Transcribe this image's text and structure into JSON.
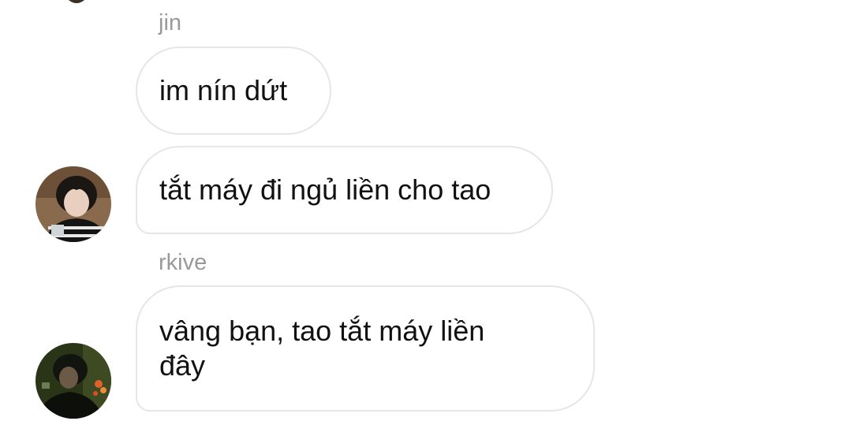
{
  "messages": [
    {
      "sender": "jin",
      "text": "im nín dứt"
    },
    {
      "text": "tắt máy đi ngủ liền cho tao"
    },
    {
      "sender": "rkive",
      "text": "vâng bạn, tao tắt máy liền đây"
    }
  ],
  "avatars": [
    {
      "icon": "user-avatar-jin"
    },
    {
      "icon": "user-avatar-rkive"
    }
  ],
  "colors": {
    "sender_name": "#999999",
    "bubble_border": "#e6e6e6",
    "message_text": "#111111"
  }
}
